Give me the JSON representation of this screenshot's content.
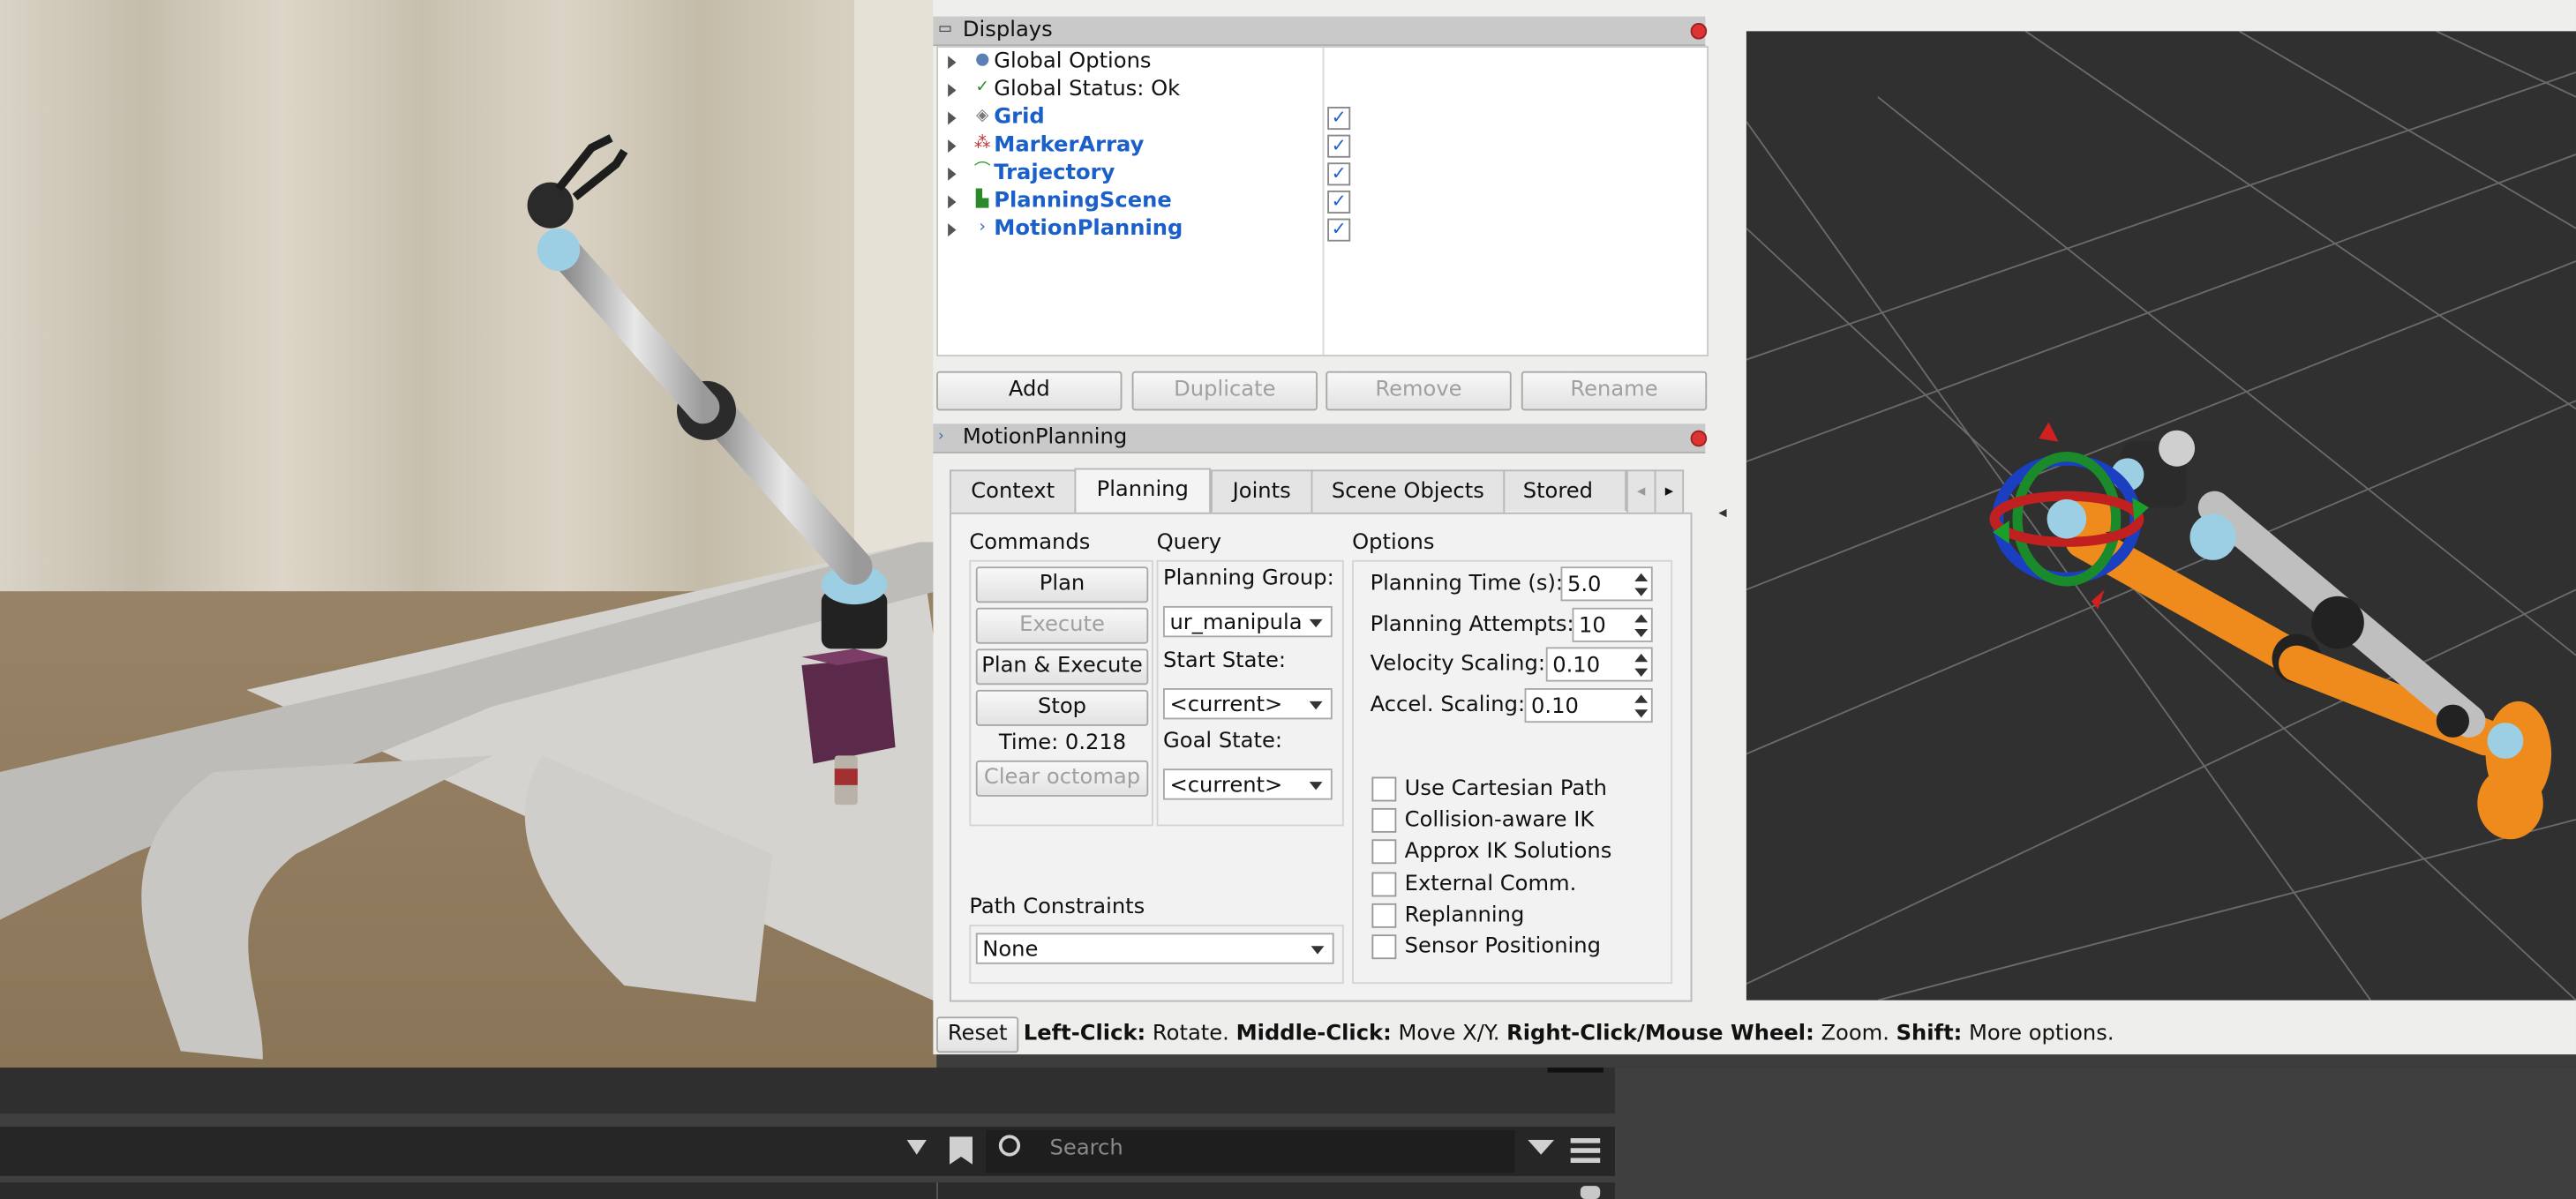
{
  "displays_panel": {
    "title": "Displays",
    "tree": [
      {
        "label": "Global Options",
        "icon": "globe-icon",
        "checked": null
      },
      {
        "label": "Global Status: Ok",
        "icon": "check-icon",
        "checked": null
      },
      {
        "label": "Grid",
        "icon": "grid-icon",
        "checked": true
      },
      {
        "label": "MarkerArray",
        "icon": "marker-icon",
        "checked": true
      },
      {
        "label": "Trajectory",
        "icon": "trajectory-icon",
        "checked": true
      },
      {
        "label": "PlanningScene",
        "icon": "planning-scene-icon",
        "checked": true
      },
      {
        "label": "MotionPlanning",
        "icon": "motion-planning-icon",
        "checked": true
      }
    ],
    "buttons": {
      "add": "Add",
      "duplicate": "Duplicate",
      "remove": "Remove",
      "rename": "Rename"
    }
  },
  "motion_planning_panel": {
    "title": "MotionPlanning",
    "tabs": [
      "Context",
      "Planning",
      "Joints",
      "Scene Objects",
      "Stored Sce"
    ],
    "active_tab": "Planning",
    "commands": {
      "heading": "Commands",
      "plan": "Plan",
      "execute": "Execute",
      "plan_execute": "Plan & Execute",
      "stop": "Stop",
      "time": "Time: 0.218",
      "clear_octomap": "Clear octomap"
    },
    "query": {
      "heading": "Query",
      "planning_group_label": "Planning Group:",
      "planning_group_value": "ur_manipula",
      "start_state_label": "Start State:",
      "start_state_value": "<current>",
      "goal_state_label": "Goal State:",
      "goal_state_value": "<current>"
    },
    "options": {
      "heading": "Options",
      "planning_time_label": "Planning Time (s):",
      "planning_time_value": "5.0",
      "planning_attempts_label": "Planning Attempts:",
      "planning_attempts_value": "10",
      "velocity_scaling_label": "Velocity Scaling:",
      "velocity_scaling_value": "0.10",
      "accel_scaling_label": "Accel. Scaling:",
      "accel_scaling_value": "0.10",
      "checkboxes": [
        {
          "label": "Use Cartesian Path",
          "checked": false
        },
        {
          "label": "Collision-aware IK",
          "checked": false
        },
        {
          "label": "Approx IK Solutions",
          "checked": false
        },
        {
          "label": "External Comm.",
          "checked": false
        },
        {
          "label": "Replanning",
          "checked": false
        },
        {
          "label": "Sensor Positioning",
          "checked": false
        }
      ]
    },
    "path_constraints": {
      "label": "Path Constraints",
      "value": "None"
    }
  },
  "status_bar": {
    "reset": "Reset",
    "left_click_key": "Left-Click:",
    "left_click_desc": " Rotate. ",
    "middle_click_key": "Middle-Click:",
    "middle_click_desc": " Move X/Y. ",
    "right_click_key": "Right-Click/Mouse Wheel:",
    "right_click_desc": " Zoom. ",
    "shift_key": "Shift:",
    "shift_desc": " More options."
  },
  "bottom_panel": {
    "search_placeholder": "Search"
  },
  "colors": {
    "robot_orange": "#ef8a1c",
    "link_blue": "#1b5fc8",
    "viewport_bg": "#303030"
  }
}
